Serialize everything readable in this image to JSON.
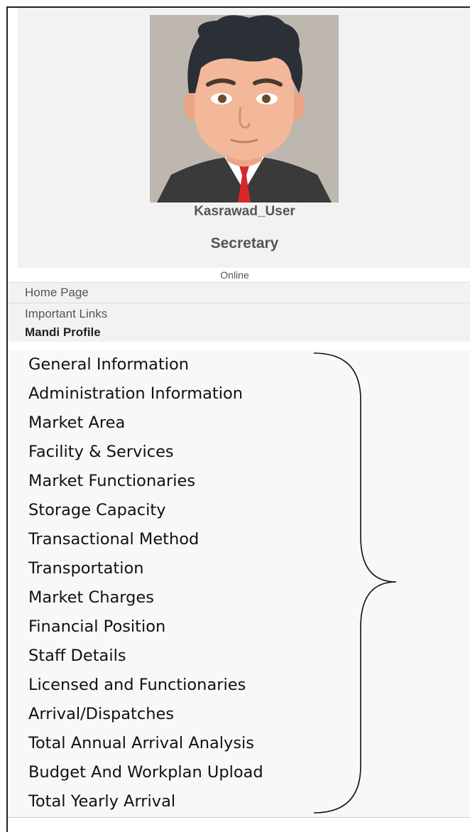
{
  "profile": {
    "avatar": "avatar-illustration",
    "username": "Kasrawad_User",
    "role": "Secretary",
    "status": "Online"
  },
  "menu": {
    "home": "Home Page",
    "important_links": "Important Links",
    "mandi_profile": "Mandi Profile"
  },
  "submenu": [
    "General Information",
    "Administration Information",
    "Market Area",
    "Facility & Services",
    "Market Functionaries",
    "Storage Capacity",
    "Transactional Method",
    "Transportation",
    "Market Charges",
    "Financial Position",
    "Staff Details",
    "Licensed and Functionaries",
    "Arrival/Dispatches",
    "Total Annual Arrival Analysis",
    "Budget And Workplan Upload",
    "Total Yearly Arrival"
  ]
}
